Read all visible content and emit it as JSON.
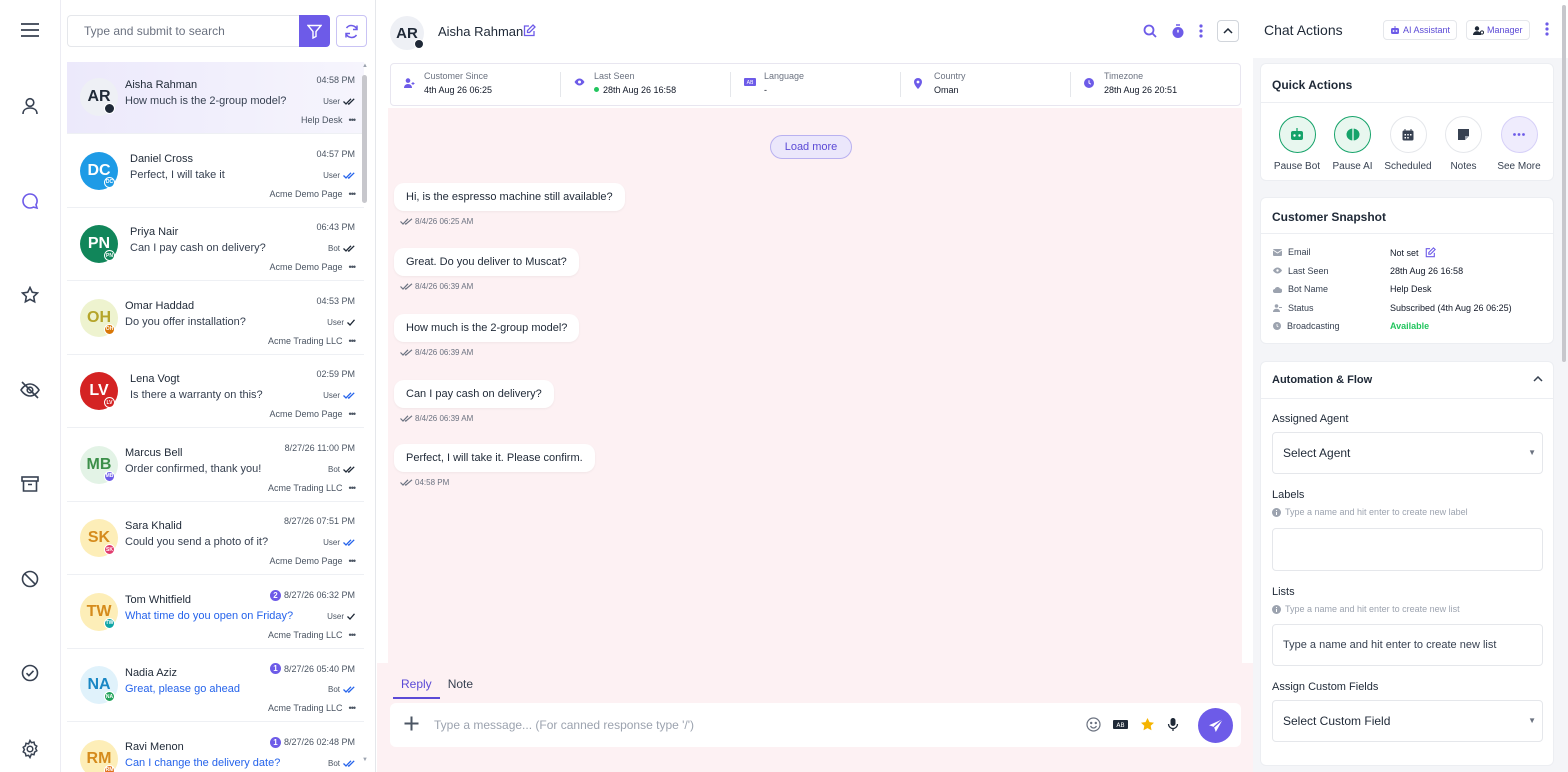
{
  "search": {
    "placeholder": "Type and submit to search"
  },
  "conversations": [
    {
      "initials": "AR",
      "name": "Aisha Rahman",
      "message": "How much is the 2-group model?",
      "time": "04:58 PM",
      "sender": "User",
      "page": "Help Desk",
      "unread": "",
      "avatar_bg": "#eef0f5",
      "avatar_fg": "#1f2937",
      "badge_bg": "#1f2937",
      "active": true,
      "msg_unread": false,
      "check_color": "#1f2937"
    },
    {
      "initials": "DC",
      "name": "Daniel Cross",
      "message": "Perfect, I will take it",
      "time": "04:57 PM",
      "sender": "User",
      "page": "Acme Demo Page",
      "unread": "",
      "avatar_bg": "#1e9be6",
      "avatar_fg": "#ffffff",
      "badge_bg": "#1e9be6",
      "badge": "DC",
      "msg_unread": false,
      "check_color": "#2563eb"
    },
    {
      "initials": "PN",
      "name": "Priya Nair",
      "message": "Can I pay cash on delivery?",
      "time": "06:43 PM",
      "sender": "Bot",
      "page": "Acme Demo Page",
      "unread": "",
      "avatar_bg": "#11865a",
      "avatar_fg": "#ffffff",
      "badge_bg": "#11865a",
      "badge": "PN",
      "msg_unread": false,
      "check_color": "#1f2937"
    },
    {
      "initials": "OH",
      "name": "Omar Haddad",
      "message": "Do you offer installation?",
      "time": "04:53 PM",
      "sender": "User",
      "page": "Acme Trading LLC",
      "unread": "",
      "avatar_bg": "#eef3cf",
      "avatar_fg": "#b5a52a",
      "badge_bg": "#d97706",
      "badge": "OH",
      "msg_unread": false,
      "check_color": "#1f2937"
    },
    {
      "initials": "LV",
      "name": "Lena Vogt",
      "message": "Is there a warranty on this?",
      "time": "02:59 PM",
      "sender": "User",
      "page": "Acme Demo Page",
      "unread": "",
      "avatar_bg": "#d42323",
      "avatar_fg": "#ffffff",
      "badge_bg": "#d42323",
      "badge": "LV",
      "msg_unread": false,
      "check_color": "#2563eb"
    },
    {
      "initials": "MB",
      "name": "Marcus Bell",
      "message": "Order confirmed, thank you!",
      "time": "8/27/26 11:00 PM",
      "sender": "Bot",
      "page": "Acme Trading LLC",
      "unread": "",
      "avatar_bg": "#e3f3e6",
      "avatar_fg": "#3c8f4a",
      "badge_bg": "#6d5be8",
      "badge": "MB",
      "msg_unread": false,
      "check_color": "#1f2937"
    },
    {
      "initials": "SK",
      "name": "Sara Khalid",
      "message": "Could you send a photo of it?",
      "time": "8/27/26 07:51 PM",
      "sender": "User",
      "page": "Acme Demo Page",
      "unread": "",
      "avatar_bg": "#fdeeb8",
      "avatar_fg": "#d58b1c",
      "badge_bg": "#e23d6e",
      "badge": "SK",
      "msg_unread": false,
      "check_color": "#2563eb"
    },
    {
      "initials": "TW",
      "name": "Tom Whitfield",
      "message": "What time do you open on Friday?",
      "time": "8/27/26 06:32 PM",
      "sender": "User",
      "page": "Acme Trading LLC",
      "unread": "2",
      "avatar_bg": "#fdeeb8",
      "avatar_fg": "#d58b1c",
      "badge_bg": "#0ea5a5",
      "badge": "TW",
      "msg_unread": true,
      "check_color": "#1f2937"
    },
    {
      "initials": "NA",
      "name": "Nadia Aziz",
      "message": "Great, please go ahead",
      "time": "8/27/26 05:40 PM",
      "sender": "Bot",
      "page": "Acme Trading LLC",
      "unread": "1",
      "avatar_bg": "#e0f2fb",
      "avatar_fg": "#1a87c4",
      "badge_bg": "#22a35a",
      "badge": "NA",
      "msg_unread": true,
      "check_color": "#2563eb"
    },
    {
      "initials": "RM",
      "name": "Ravi Menon",
      "message": "Can I change the delivery date?",
      "time": "8/27/26 02:48 PM",
      "sender": "Bot",
      "page": "",
      "unread": "1",
      "avatar_bg": "#fdeeb8",
      "avatar_fg": "#d58b1c",
      "badge_bg": "#e2711d",
      "badge": "RM",
      "msg_unread": true,
      "check_color": "#2563eb"
    }
  ],
  "chat": {
    "initials": "AR",
    "name": "Aisha Rahman",
    "info": [
      {
        "label": "Customer Since",
        "value": "4th Aug 26 06:25",
        "icon": "user-add-icon"
      },
      {
        "label": "Last Seen",
        "value": "28th Aug 26 16:58",
        "icon": "eye-icon",
        "online": true
      },
      {
        "label": "Language",
        "value": "-",
        "icon": "language-icon"
      },
      {
        "label": "Country",
        "value": "Oman",
        "icon": "location-pin-icon"
      },
      {
        "label": "Timezone",
        "value": "28th Aug 26 20:51",
        "icon": "clock-icon"
      }
    ],
    "load_more": "Load more",
    "messages": [
      {
        "text": "Hi, is the espresso machine still available?",
        "time": "8/4/26 06:25 AM"
      },
      {
        "text": "Great. Do you deliver to Muscat?",
        "time": "8/4/26 06:39 AM"
      },
      {
        "text": "How much is the 2-group model?",
        "time": "8/4/26 06:39 AM"
      },
      {
        "text": "Can I pay cash on delivery?",
        "time": "8/4/26 06:39 AM"
      },
      {
        "text": "Perfect, I will take it. Please confirm.",
        "time": "04:58 PM"
      }
    ],
    "tabs": [
      "Reply",
      "Note"
    ],
    "composer_placeholder": "Type a message... (For canned response type '/')"
  },
  "actions": {
    "title": "Chat Actions",
    "ai_assistant": "AI Assistant",
    "manager": "Manager",
    "quick_actions_title": "Quick Actions",
    "quick_actions": [
      {
        "label": "Pause Bot",
        "icon": "robot-icon"
      },
      {
        "label": "Pause AI",
        "icon": "brain-icon"
      },
      {
        "label": "Scheduled",
        "icon": "calendar-icon"
      },
      {
        "label": "Notes",
        "icon": "note-icon"
      },
      {
        "label": "See More",
        "icon": "more-icon"
      }
    ],
    "snapshot_title": "Customer Snapshot",
    "snapshot": [
      {
        "label": "Email",
        "value": "Not set"
      },
      {
        "label": "Last Seen",
        "value": "28th Aug 26 16:58"
      },
      {
        "label": "Bot Name",
        "value": "Help Desk"
      },
      {
        "label": "Status",
        "value": "Subscribed (4th Aug 26 06:25)"
      },
      {
        "label": "Broadcasting",
        "value": "Available"
      }
    ],
    "automation_title": "Automation & Flow",
    "assigned_agent_label": "Assigned Agent",
    "assigned_agent_value": "Select Agent",
    "labels_label": "Labels",
    "labels_hint": "Type a name and hit enter to create new label",
    "lists_label": "Lists",
    "lists_hint": "Type a name and hit enter to create new list",
    "lists_placeholder": "Type a name and hit enter to create new list",
    "custom_fields_label": "Assign Custom Fields",
    "custom_fields_value": "Select Custom Field"
  },
  "colors": {
    "accent": "#6d5be8",
    "available": "#22c55e",
    "online": "#22c55e"
  }
}
